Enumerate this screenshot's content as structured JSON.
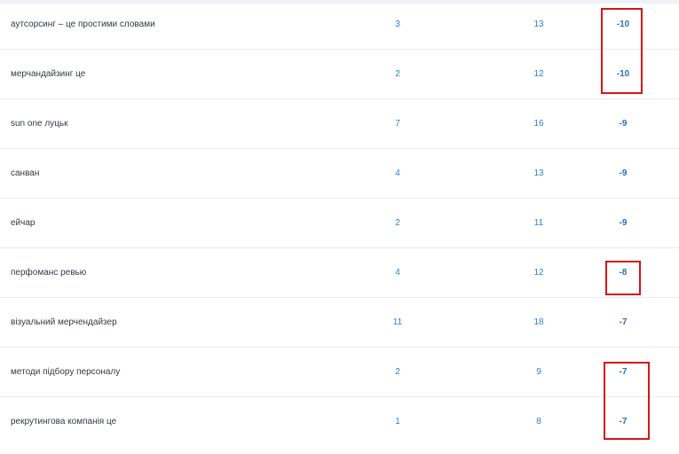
{
  "rows": [
    {
      "keyword": "аутсорсинг – це простими словами",
      "prev": "3",
      "curr": "13",
      "diff": "-10"
    },
    {
      "keyword": "мерчандайзинг це",
      "prev": "2",
      "curr": "12",
      "diff": "-10"
    },
    {
      "keyword": "sun one луцьк",
      "prev": "7",
      "curr": "16",
      "diff": "-9"
    },
    {
      "keyword": "санван",
      "prev": "4",
      "curr": "13",
      "diff": "-9"
    },
    {
      "keyword": "ейчар",
      "prev": "2",
      "curr": "11",
      "diff": "-9"
    },
    {
      "keyword": "перфоманс ревью",
      "prev": "4",
      "curr": "12",
      "diff": "-8"
    },
    {
      "keyword": "візуальний мерчендайзер",
      "prev": "11",
      "curr": "18",
      "diff": "-7"
    },
    {
      "keyword": "методи підбору персоналу",
      "prev": "2",
      "curr": "9",
      "diff": "-7"
    },
    {
      "keyword": "рекрутингова компанія це",
      "prev": "1",
      "curr": "8",
      "diff": "-7"
    }
  ],
  "colors": {
    "keyword_text": "#333a44",
    "number_text": "#2f7fd4",
    "diff_text": "#2a6fc2",
    "highlight_box": "#d8141a",
    "row_divider": "#e8ebf0"
  }
}
